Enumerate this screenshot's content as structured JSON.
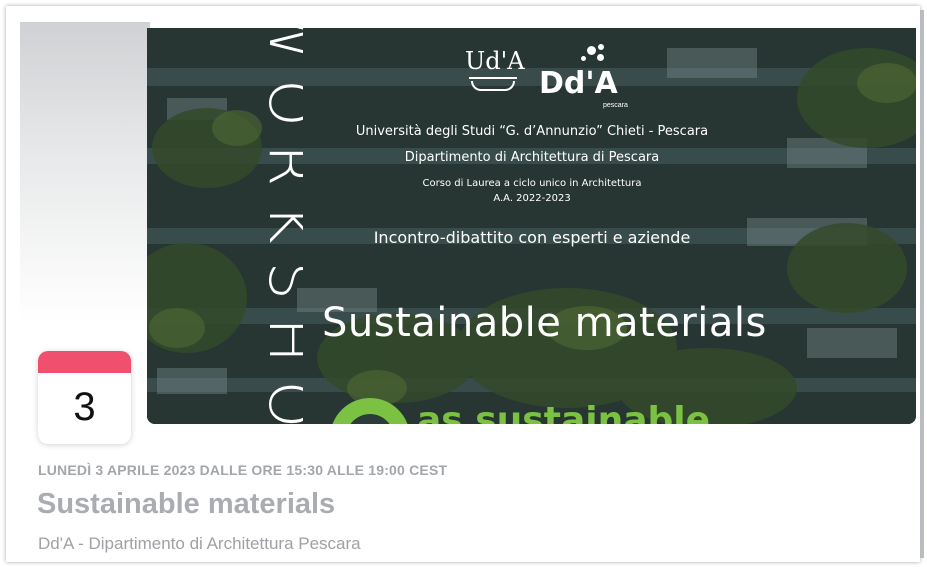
{
  "banner": {
    "vertical_word": "WORKSHOP",
    "logos": {
      "uda": "Ud'A",
      "dda": "Dd'A",
      "dda_sub": "pescara"
    },
    "university": "Università degli Studi “G. d’Annunzio” Chieti - Pescara",
    "department": "Dipartimento di Architettura di Pescara",
    "course": "Corso di Laurea a ciclo unico in Architettura",
    "academic_year": "A.A. 2022-2023",
    "meeting": "Incontro-dibattito con esperti e aziende",
    "headline": "Sustainable materials",
    "partner_partial": "as sustainable",
    "colors": {
      "overlay": "#2a3a36",
      "foliage": "#3d5a2a",
      "facade": "#6d8890"
    }
  },
  "date_badge": {
    "day": "3",
    "accent_color": "#f0506e"
  },
  "event": {
    "datetime": "LUNEDÌ 3 APRILE 2023 DALLE ORE 15:30 ALLE 19:00 CEST",
    "title": "Sustainable materials",
    "organizer": "Dd'A - Dipartimento di Architettura Pescara"
  }
}
